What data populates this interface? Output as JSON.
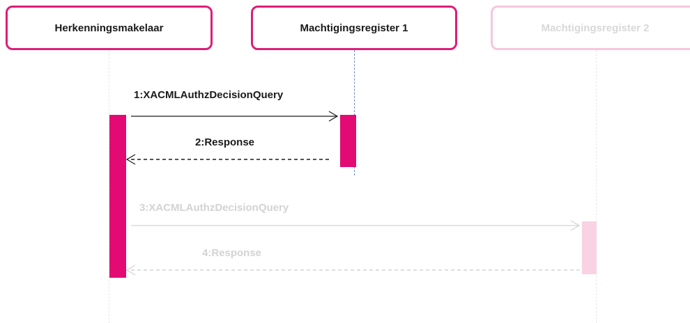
{
  "lifelines": {
    "herkenningsmakelaar": "Herkenningsmakelaar",
    "machtigingsregister1": "Machtigingsregister 1",
    "machtigingsregister2": "Machtigingsregister 2"
  },
  "messages": {
    "msg1": "1:XACMLAuthzDecisionQuery",
    "msg2": "2:Response",
    "msg3": "3:XACMLAuthzDecisionQuery",
    "msg4": "4:Response"
  },
  "colors": {
    "active_accent": "#e30b73",
    "inactive_accent": "#f6c5dc",
    "inactive_text": "#d3d3d3"
  }
}
